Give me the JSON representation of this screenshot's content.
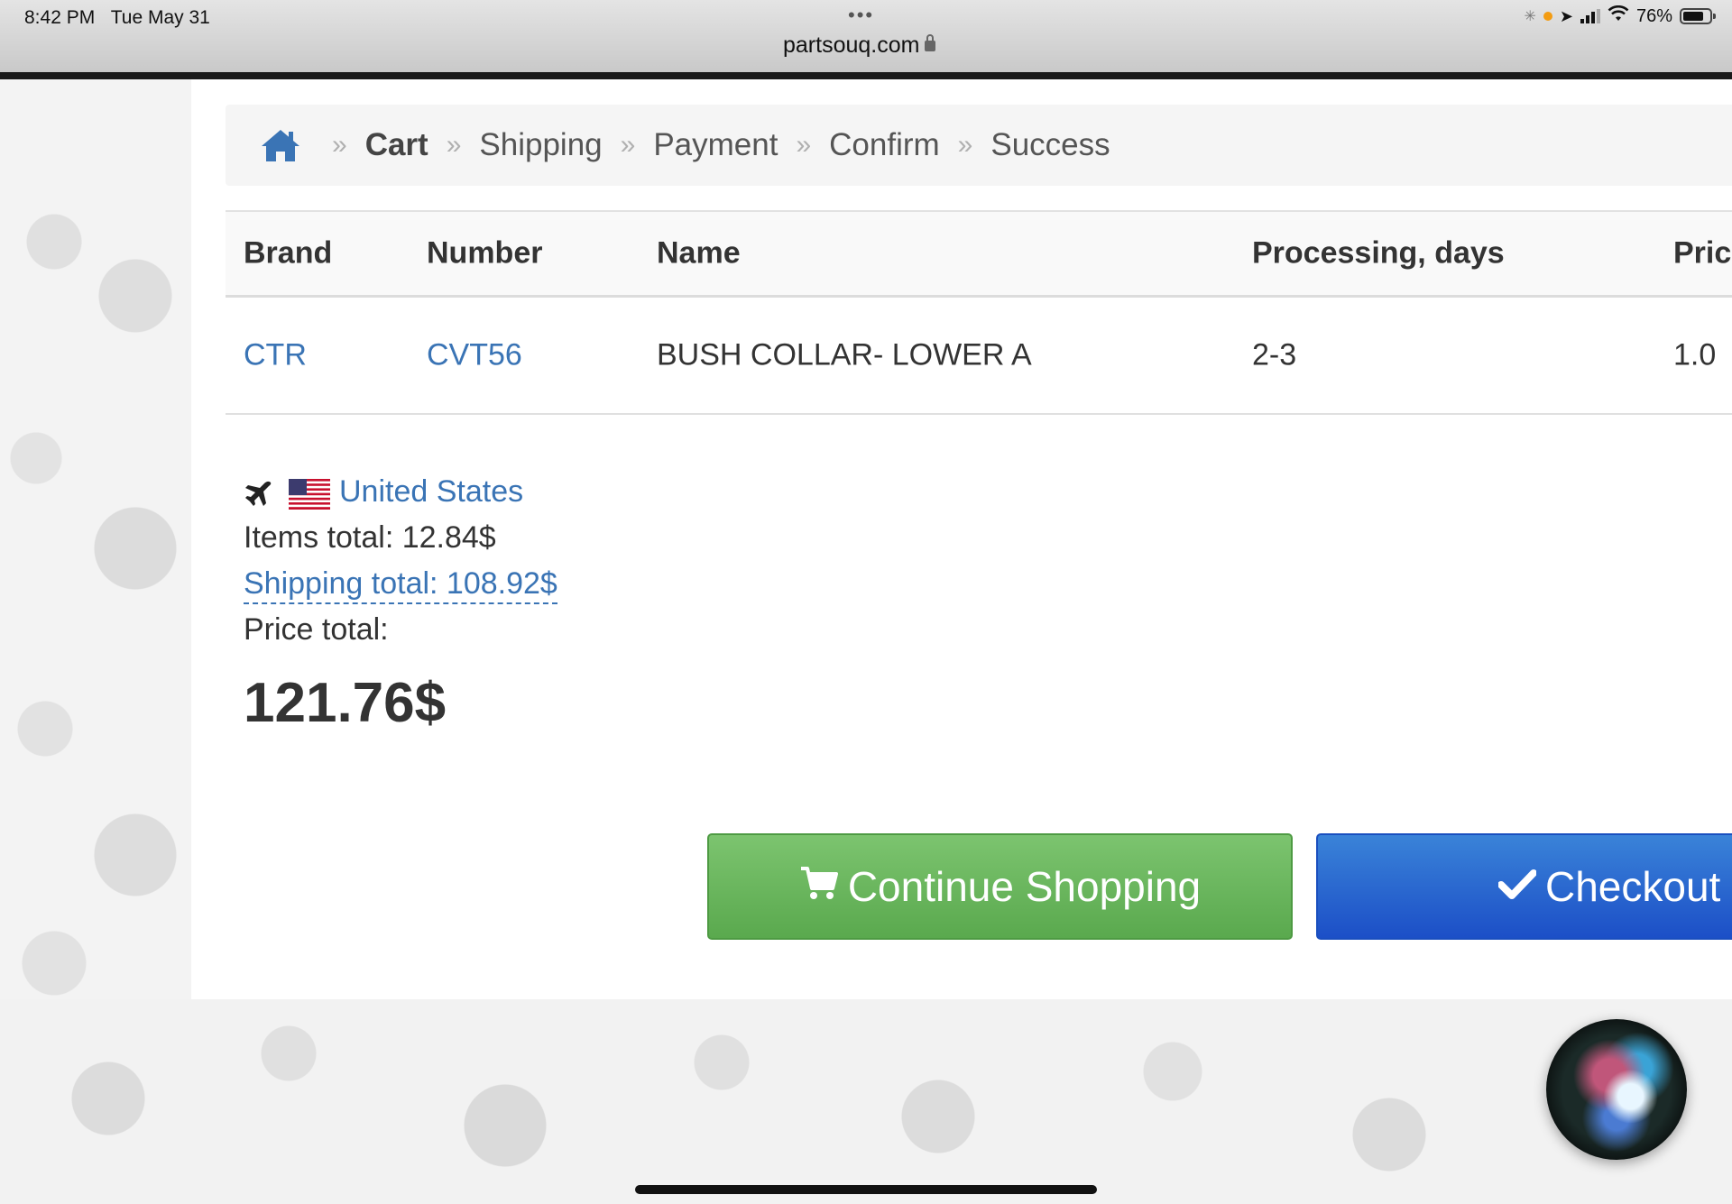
{
  "status_bar": {
    "time": "8:42 PM",
    "date": "Tue May 31",
    "battery": "76%",
    "dots": "•••",
    "url": "partsouq.com"
  },
  "breadcrumb": {
    "items": [
      "Cart",
      "Shipping",
      "Payment",
      "Confirm",
      "Success"
    ],
    "separator": "»",
    "active": "Cart"
  },
  "table": {
    "headers": [
      "Brand",
      "Number",
      "Name",
      "Processing, days",
      "Pric"
    ],
    "rows": [
      {
        "brand": "CTR",
        "number": "CVT56",
        "name": "BUSH COLLAR- LOWER A",
        "processing": "2-3",
        "price": "1.0"
      }
    ]
  },
  "summary": {
    "country": "United States",
    "items_total": "Items total: 12.84$",
    "shipping_total": "Shipping total: 108.92$",
    "price_total_label": "Price total:",
    "price_total_value": "121.76$"
  },
  "buttons": {
    "continue_label": "Continue Shopping",
    "checkout_label": "Checkout"
  },
  "colors": {
    "link": "#3a74b5",
    "continue_button": "#5aa94e",
    "checkout_button": "#1c4fc7"
  }
}
